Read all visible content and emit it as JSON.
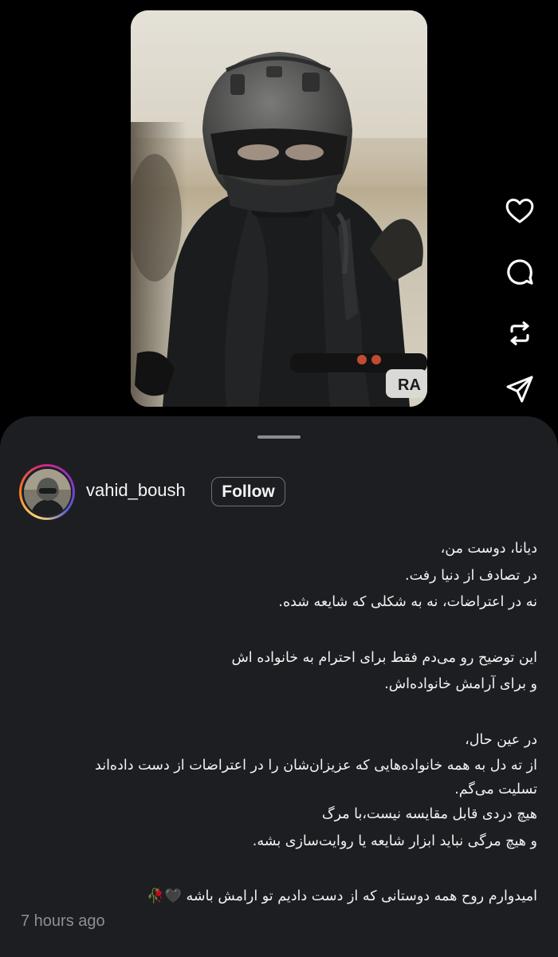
{
  "post": {
    "username": "vahid_boush",
    "follow_label": "Follow",
    "timestamp": "7 hours ago"
  },
  "actions": {
    "like_icon": "heart-icon",
    "comment_icon": "comment-bubble-icon",
    "repost_icon": "repost-icon",
    "share_icon": "send-icon"
  },
  "caption": {
    "lines": [
      "دیانا، دوست من،",
      "در تصادف از دنیا رفت.",
      "نه در اعتراضات، نه به شکلی که شایعه شده.",
      "این توضیح رو می‌دم فقط برای احترام به خانواده اش",
      "و برای آرامش خانواده‌اش.",
      "در عین حال،",
      "از ته دل به همه خانواده‌هایی که عزیزان‌شان را در اعتراضات از دست داده‌اند",
      "تسلیت می‌گم.",
      "هیچ دردی قابل مقایسه نیست،با مرگ",
      "و هیچ مرگی نباید ابزار شایعه یا روایت‌سازی بشه.",
      "امیدوارم روح همه دوستانی که از دست دادیم  تو ارامش باشه",
      "🖤🥀"
    ]
  },
  "colors": {
    "background": "#000000",
    "sheet": "#1c1e22",
    "text": "#f2f2f2",
    "muted": "#8d8f93"
  }
}
